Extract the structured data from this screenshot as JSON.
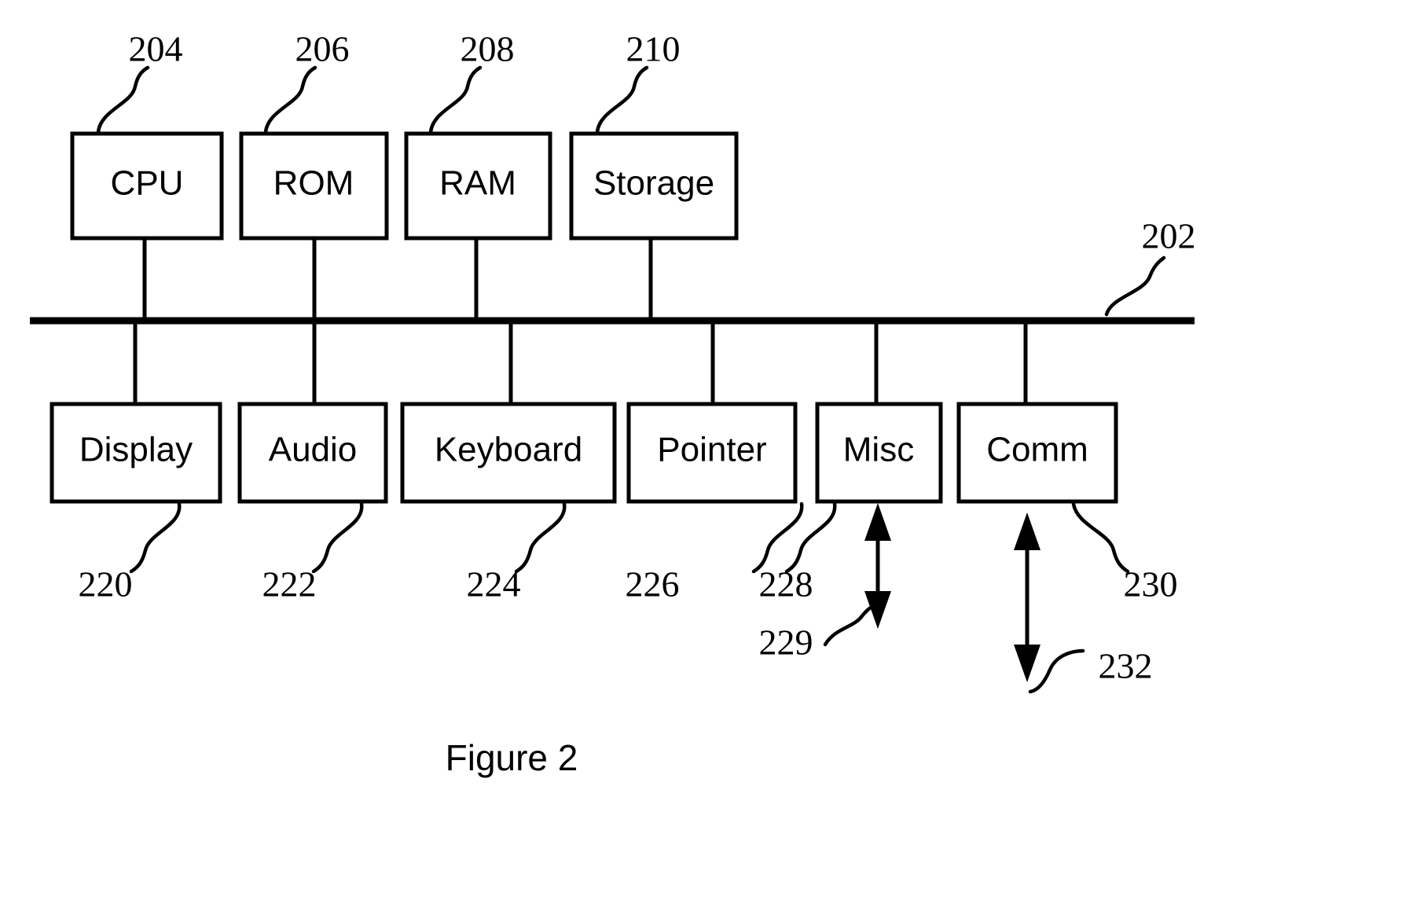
{
  "figure": {
    "caption": "Figure 2",
    "bus_label": "202"
  },
  "top_row": [
    {
      "label": "CPU",
      "ref": "204"
    },
    {
      "label": "ROM",
      "ref": "206"
    },
    {
      "label": "RAM",
      "ref": "208"
    },
    {
      "label": "Storage",
      "ref": "210"
    }
  ],
  "bottom_row": [
    {
      "label": "Display",
      "ref": "220"
    },
    {
      "label": "Audio",
      "ref": "222"
    },
    {
      "label": "Keyboard",
      "ref": "224"
    },
    {
      "label": "Pointer",
      "ref": "226"
    },
    {
      "label": "Misc",
      "ref": "228"
    },
    {
      "label": "Comm",
      "ref": "230"
    }
  ],
  "external_links": [
    {
      "ref": "229",
      "source": "Misc"
    },
    {
      "ref": "232",
      "source": "Comm"
    }
  ],
  "colors": {
    "ink": "#000000",
    "paper": "#ffffff"
  }
}
